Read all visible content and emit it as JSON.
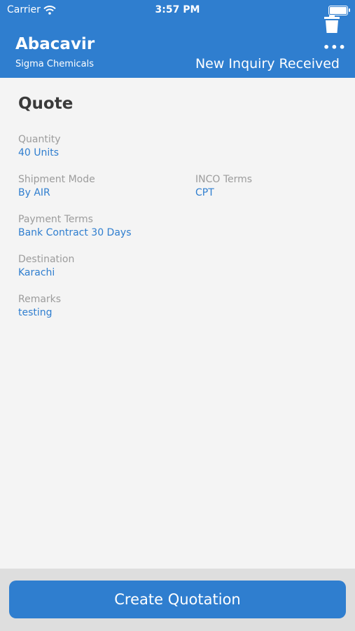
{
  "status_bar": {
    "carrier": "Carrier",
    "time": "3:57 PM"
  },
  "header": {
    "title": "Abacavir",
    "subtitle": "Sigma Chemicals",
    "status": "New Inquiry Received",
    "more_label": "•••"
  },
  "quote": {
    "section_title": "Quote",
    "quantity": {
      "label": "Quantity",
      "value": "40 Units"
    },
    "shipment_mode": {
      "label": "Shipment Mode",
      "value": "By AIR"
    },
    "inco_terms": {
      "label": "INCO Terms",
      "value": "CPT"
    },
    "payment_terms": {
      "label": "Payment Terms",
      "value": "Bank Contract 30 Days"
    },
    "destination": {
      "label": "Destination",
      "value": "Karachi"
    },
    "remarks": {
      "label": "Remarks",
      "value": "testing"
    }
  },
  "footer": {
    "button_label": "Create Quotation"
  },
  "colors": {
    "accent": "#2f7ecf",
    "background": "#f4f4f4",
    "label": "#9c9c9c"
  }
}
